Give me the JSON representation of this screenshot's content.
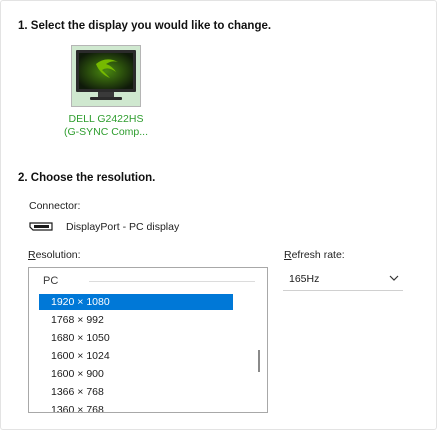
{
  "step1": {
    "title": "1. Select the display you would like to change."
  },
  "display": {
    "name_line1": "DELL G2422HS",
    "name_line2": "(G-SYNC Comp..."
  },
  "step2": {
    "title": "2. Choose the resolution."
  },
  "connector": {
    "label": "Connector:",
    "value": "DisplayPort - PC display",
    "icon": "displayport-icon"
  },
  "resolution": {
    "label_prefix": "R",
    "label_rest": "esolution:",
    "group": "PC",
    "items": [
      "1920 × 1080",
      "1768 × 992",
      "1680 × 1050",
      "1600 × 1024",
      "1600 × 900",
      "1366 × 768",
      "1360 × 768"
    ],
    "selected": "1920 × 1080"
  },
  "refresh": {
    "label_prefix": "R",
    "label_rest": "efresh rate:",
    "value": "165Hz"
  },
  "colors": {
    "accent": "#0078d7",
    "display_label": "#2e9d2e",
    "nvidia_green": "#76b900"
  }
}
